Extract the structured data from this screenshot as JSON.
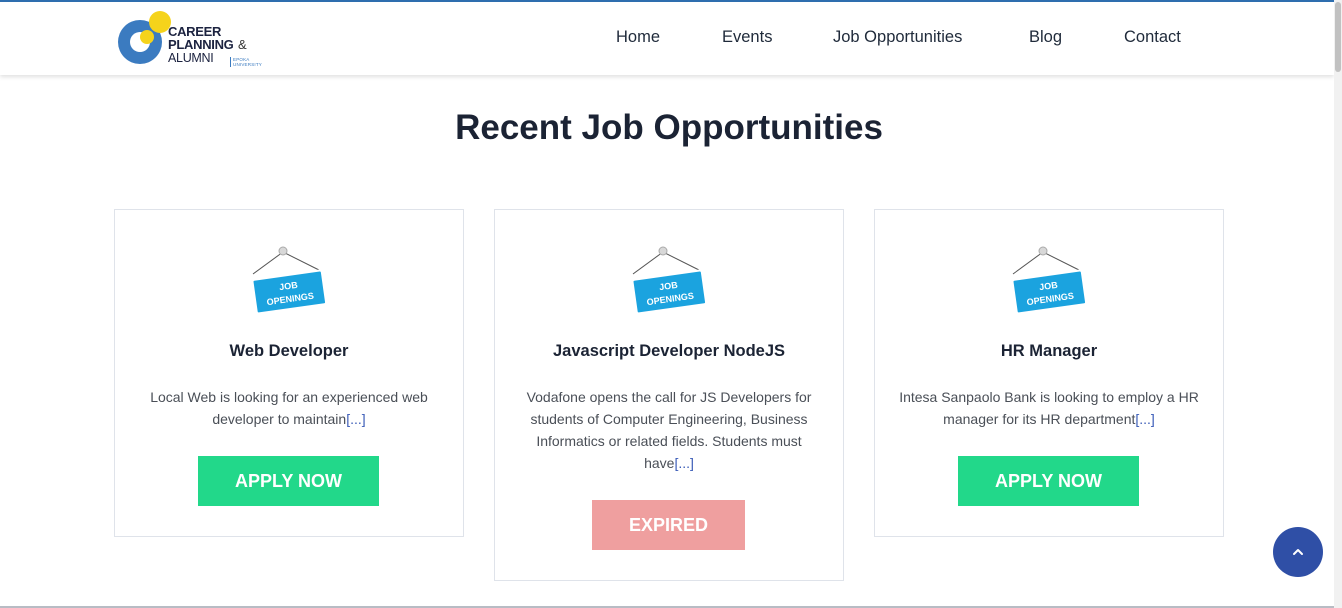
{
  "brand": {
    "line1": "CAREER",
    "line2": "PLANNING",
    "amp": "&",
    "line3": "ALUMNI",
    "university": "EPOKA UNIVERSITY",
    "colors": {
      "blue": "#3b7bc0",
      "yellow": "#f5d31b"
    }
  },
  "nav": {
    "items": [
      {
        "label": "Home"
      },
      {
        "label": "Events"
      },
      {
        "label": "Job Opportunities"
      },
      {
        "label": "Blog"
      },
      {
        "label": "Contact"
      }
    ]
  },
  "main": {
    "title": "Recent Job Opportunities",
    "icon_sign_text": [
      "JOB",
      "OPENINGS"
    ],
    "more_text": "[...]",
    "jobs": [
      {
        "title": "Web Developer",
        "description": "Local Web is looking for an experienced web developer to maintain",
        "button": "APPLY NOW",
        "status": "open"
      },
      {
        "title": "Javascript Developer NodeJS",
        "description": "Vodafone opens the call for JS Developers for students of Computer Engineering, Business Informatics or related fields. Students must have",
        "button": "EXPIRED",
        "status": "expired"
      },
      {
        "title": "HR Manager",
        "description": "Intesa Sanpaolo Bank is looking to employ a HR manager for its HR department",
        "button": "APPLY NOW",
        "status": "open"
      }
    ]
  },
  "colors": {
    "apply": "#22d88a",
    "expired": "#ef9f9f",
    "scroll_top": "#2f4fa6",
    "link": "#3a5bb7"
  },
  "scroll_top_icon": "chevron-up-icon"
}
